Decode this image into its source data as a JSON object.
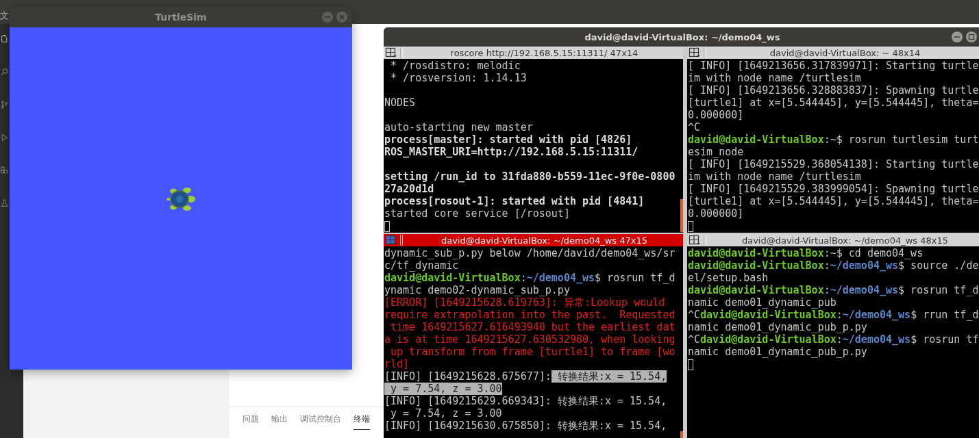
{
  "desktop": {
    "menu_text": "文"
  },
  "editor": {
    "panel_tabs": [
      {
        "label": "问题",
        "selected": false
      },
      {
        "label": "输出",
        "selected": false
      },
      {
        "label": "调试控制台",
        "selected": false
      },
      {
        "label": "终端",
        "selected": true
      }
    ]
  },
  "turtlesim": {
    "title": "TurtleSim"
  },
  "terminal": {
    "title": "david@david-VirtualBox: ~/demo04_ws",
    "panes": [
      {
        "title": "roscore http://192.168.5.15:11311/ 47x14",
        "active": false,
        "lines": [
          {
            "kind": "text",
            "segments": [
              {
                "kind": "plain",
                "text": " * /rosdistro: melodic"
              }
            ]
          },
          {
            "kind": "text",
            "segments": [
              {
                "kind": "plain",
                "text": " * /rosversion: 1.14.13"
              }
            ]
          },
          {
            "kind": "blank"
          },
          {
            "kind": "text",
            "segments": [
              {
                "kind": "plain",
                "text": "NODES"
              }
            ]
          },
          {
            "kind": "blank"
          },
          {
            "kind": "text",
            "segments": [
              {
                "kind": "plain",
                "text": "auto-starting new master"
              }
            ]
          },
          {
            "kind": "text",
            "segments": [
              {
                "kind": "bold",
                "text": "process[master]: started with pid [4826]"
              }
            ]
          },
          {
            "kind": "text",
            "segments": [
              {
                "kind": "bold",
                "text": "ROS_MASTER_URI=http://192.168.5.15:11311/"
              }
            ]
          },
          {
            "kind": "blank"
          },
          {
            "kind": "text",
            "segments": [
              {
                "kind": "bold",
                "text": "setting /run_id to 31fda880-b559-11ec-9f0e-0800"
              }
            ]
          },
          {
            "kind": "text",
            "segments": [
              {
                "kind": "bold",
                "text": "27a20d1d"
              }
            ]
          },
          {
            "kind": "text",
            "segments": [
              {
                "kind": "bold",
                "text": "process[rosout-1]: started with pid [4841]"
              }
            ]
          },
          {
            "kind": "text",
            "segments": [
              {
                "kind": "plain",
                "text": "started core service [/rosout]"
              }
            ]
          },
          {
            "kind": "cursor"
          }
        ]
      },
      {
        "title": "david@david-VirtualBox: ~ 48x14",
        "active": false,
        "lines": [
          {
            "kind": "text",
            "segments": [
              {
                "kind": "plain",
                "text": "[ INFO] [1649213656.317839971]: Starting turtle"
              }
            ]
          },
          {
            "kind": "text",
            "segments": [
              {
                "kind": "plain",
                "text": "im with node name /turtlesim"
              }
            ]
          },
          {
            "kind": "text",
            "segments": [
              {
                "kind": "plain",
                "text": "[ INFO] [1649213656.328883837]: Spawning turtle"
              }
            ]
          },
          {
            "kind": "text",
            "segments": [
              {
                "kind": "plain",
                "text": "[turtle1] at x=[5.544445], y=[5.544445], theta="
              }
            ]
          },
          {
            "kind": "text",
            "segments": [
              {
                "kind": "plain",
                "text": "0.000000]"
              }
            ]
          },
          {
            "kind": "text",
            "segments": [
              {
                "kind": "plain",
                "text": "^C"
              }
            ]
          },
          {
            "kind": "text",
            "segments": [
              {
                "kind": "user",
                "text": "david@david-VirtualBox"
              },
              {
                "kind": "plain",
                "text": ":~$ rosrun turtlesim turt"
              }
            ]
          },
          {
            "kind": "text",
            "segments": [
              {
                "kind": "plain",
                "text": "esim_node"
              }
            ]
          },
          {
            "kind": "text",
            "segments": [
              {
                "kind": "plain",
                "text": "[ INFO] [1649215529.368054138]: Starting turtle"
              }
            ]
          },
          {
            "kind": "text",
            "segments": [
              {
                "kind": "plain",
                "text": "im with node name /turtlesim"
              }
            ]
          },
          {
            "kind": "text",
            "segments": [
              {
                "kind": "plain",
                "text": "[ INFO] [1649215529.383999054]: Spawning turtle"
              }
            ]
          },
          {
            "kind": "text",
            "segments": [
              {
                "kind": "plain",
                "text": "[turtle1] at x=[5.544445], y=[5.544445], theta="
              }
            ]
          },
          {
            "kind": "text",
            "segments": [
              {
                "kind": "plain",
                "text": "0.000000]"
              }
            ]
          },
          {
            "kind": "cursor"
          }
        ]
      },
      {
        "title": "david@david-VirtualBox: ~/demo04_ws 47x15",
        "active": true,
        "lines": [
          {
            "kind": "text",
            "segments": [
              {
                "kind": "plain",
                "text": "dynamic_sub_p.py below /home/david/demo04_ws/sr"
              }
            ]
          },
          {
            "kind": "text",
            "segments": [
              {
                "kind": "plain",
                "text": "c/tf_dynamic"
              }
            ]
          },
          {
            "kind": "text",
            "segments": [
              {
                "kind": "user",
                "text": "david@david-VirtualBox"
              },
              {
                "kind": "plain",
                "text": ":"
              },
              {
                "kind": "path",
                "text": "~/demo04_ws"
              },
              {
                "kind": "plain",
                "text": "$ rosrun tf_d"
              }
            ]
          },
          {
            "kind": "text",
            "segments": [
              {
                "kind": "plain",
                "text": "ynamic demo02-dynamic_sub_p.py"
              }
            ]
          },
          {
            "kind": "text",
            "segments": [
              {
                "kind": "error",
                "text": "[ERROR] [1649215628.619763]: 异常:Lookup would"
              }
            ]
          },
          {
            "kind": "text",
            "segments": [
              {
                "kind": "error",
                "text": "require extrapolation into the past.  Requested"
              }
            ]
          },
          {
            "kind": "text",
            "segments": [
              {
                "kind": "error",
                "text": " time 1649215627.616493940 but the earliest dat"
              }
            ]
          },
          {
            "kind": "text",
            "segments": [
              {
                "kind": "error",
                "text": "a is at time 1649215627.630532980, when looking"
              }
            ]
          },
          {
            "kind": "text",
            "segments": [
              {
                "kind": "error",
                "text": " up transform from frame [turtle1] to frame [wo"
              }
            ]
          },
          {
            "kind": "text",
            "segments": [
              {
                "kind": "error",
                "text": "rld]"
              }
            ]
          },
          {
            "kind": "text",
            "segments": [
              {
                "kind": "plain",
                "text": "[INFO] [1649215628.675677]:"
              },
              {
                "kind": "highlight",
                "text": " 转换结果:x = 15.54,"
              }
            ]
          },
          {
            "kind": "text",
            "segments": [
              {
                "kind": "highlight",
                "text": " y = 7.54, z = 3.00"
              }
            ]
          },
          {
            "kind": "text",
            "segments": [
              {
                "kind": "plain",
                "text": "[INFO] [1649215629.669343]: 转换结果:x = 15.54,"
              }
            ]
          },
          {
            "kind": "text",
            "segments": [
              {
                "kind": "plain",
                "text": " y = 7.54, z = 3.00"
              }
            ]
          },
          {
            "kind": "text",
            "segments": [
              {
                "kind": "plain",
                "text": "[INFO] [1649215630.675850]: 转换结果:x = 15.54,"
              }
            ]
          }
        ]
      },
      {
        "title": "david@david-VirtualBox: ~/demo04_ws 48x15",
        "active": false,
        "lines": [
          {
            "kind": "text",
            "segments": [
              {
                "kind": "user",
                "text": "david@david-VirtualBox"
              },
              {
                "kind": "plain",
                "text": ":~$ cd demo04_ws"
              }
            ]
          },
          {
            "kind": "text",
            "segments": [
              {
                "kind": "user",
                "text": "david@david-VirtualBox"
              },
              {
                "kind": "plain",
                "text": ":"
              },
              {
                "kind": "path",
                "text": "~/demo04_ws"
              },
              {
                "kind": "plain",
                "text": "$ source ./de"
              }
            ]
          },
          {
            "kind": "text",
            "segments": [
              {
                "kind": "plain",
                "text": "el/setup.bash"
              }
            ]
          },
          {
            "kind": "text",
            "segments": [
              {
                "kind": "user",
                "text": "david@david-VirtualBox"
              },
              {
                "kind": "plain",
                "text": ":"
              },
              {
                "kind": "path",
                "text": "~/demo04_ws"
              },
              {
                "kind": "plain",
                "text": "$ rosrun tf_d"
              }
            ]
          },
          {
            "kind": "text",
            "segments": [
              {
                "kind": "plain",
                "text": "namic demo01_dynamic_pub"
              }
            ]
          },
          {
            "kind": "text",
            "segments": [
              {
                "kind": "plain",
                "text": "^C"
              },
              {
                "kind": "user",
                "text": "david@david-VirtualBox"
              },
              {
                "kind": "plain",
                "text": ":"
              },
              {
                "kind": "path",
                "text": "~/demo04_ws"
              },
              {
                "kind": "plain",
                "text": "$ rrun tf_d"
              }
            ]
          },
          {
            "kind": "text",
            "segments": [
              {
                "kind": "plain",
                "text": "namic demo01_dynamic_pub_p.py"
              }
            ]
          },
          {
            "kind": "text",
            "segments": [
              {
                "kind": "plain",
                "text": "^C"
              },
              {
                "kind": "user",
                "text": "david@david-VirtualBox"
              },
              {
                "kind": "plain",
                "text": ":"
              },
              {
                "kind": "path",
                "text": "~/demo04_ws"
              },
              {
                "kind": "plain",
                "text": "$ rosrun tf"
              }
            ]
          },
          {
            "kind": "text",
            "segments": [
              {
                "kind": "plain",
                "text": "namic demo01_dynamic_pub_p.py"
              }
            ]
          },
          {
            "kind": "cursor"
          }
        ]
      }
    ]
  }
}
